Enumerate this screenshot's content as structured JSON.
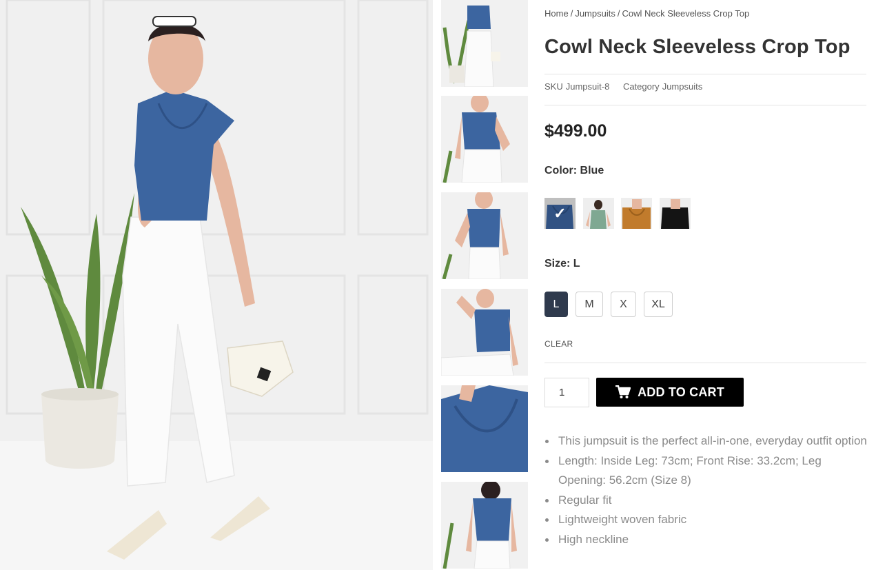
{
  "breadcrumb": {
    "home": "Home",
    "category": "Jumpsuits",
    "current": "Cowl Neck Sleeveless Crop Top",
    "separator": "/"
  },
  "product": {
    "title": "Cowl Neck Sleeveless Crop Top",
    "sku_label": "SKU",
    "sku": "Jumpsuit-8",
    "category_label": "Category",
    "category": "Jumpsuits",
    "price": "$499.00"
  },
  "color": {
    "label": "Color: Blue",
    "selected": "Blue",
    "swatches": [
      {
        "name": "Blue",
        "hex": "#3c65a0",
        "selected": true
      },
      {
        "name": "Green",
        "hex": "#7fa892",
        "selected": false
      },
      {
        "name": "Mustard",
        "hex": "#c17b2c",
        "selected": false
      },
      {
        "name": "Black",
        "hex": "#141414",
        "selected": false
      }
    ]
  },
  "size": {
    "label": "Size: L",
    "options": [
      {
        "label": "L",
        "selected": true
      },
      {
        "label": "M",
        "selected": false
      },
      {
        "label": "X",
        "selected": false
      },
      {
        "label": "XL",
        "selected": false
      }
    ],
    "clear_label": "CLEAR"
  },
  "cart": {
    "quantity": "1",
    "add_label": "ADD TO CART",
    "icon": "cart-icon"
  },
  "features": [
    "This jumpsuit is the perfect all-in-one, everyday outfit option",
    "Length: Inside Leg: 73cm; Front Rise: 33.2cm; Leg Opening: 56.2cm (Size 8)",
    "Regular fit",
    "Lightweight woven fabric",
    "High neckline"
  ],
  "colors": {
    "top_blue": "#3c65a0",
    "button_black": "#000000",
    "size_active": "#2f3a4d",
    "feature_text": "#8a8a8a"
  }
}
